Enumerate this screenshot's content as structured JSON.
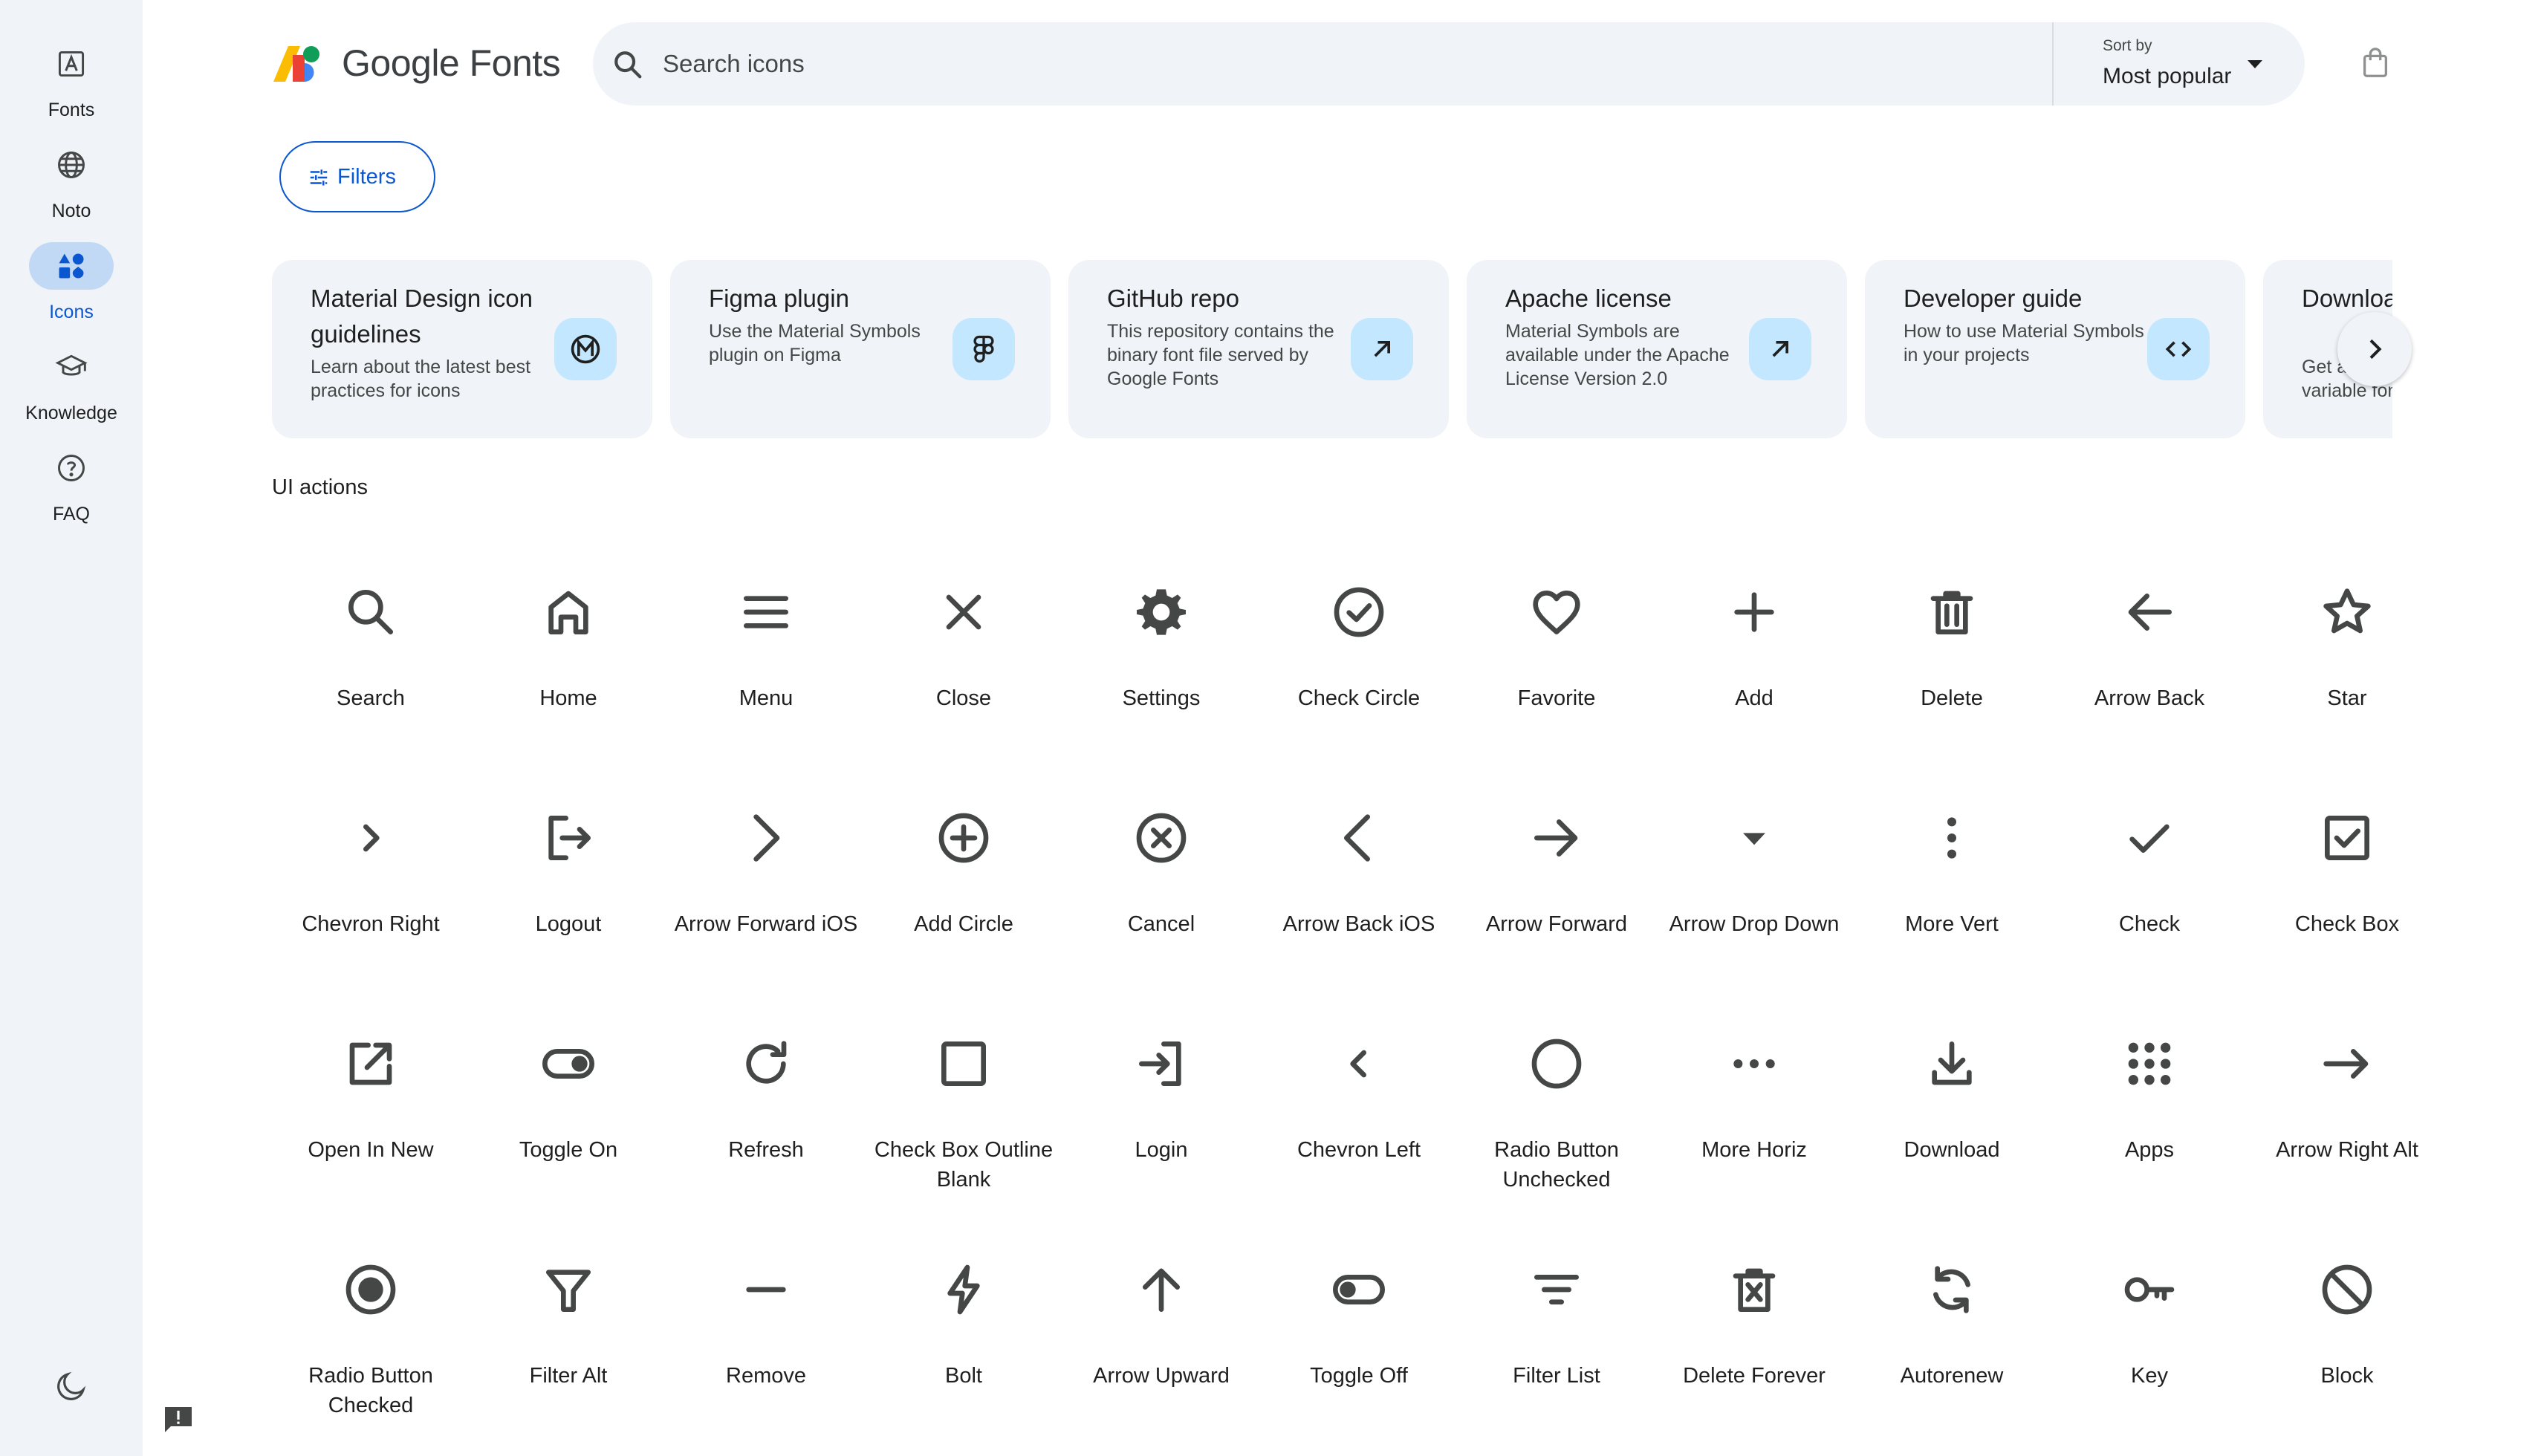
{
  "rail": {
    "items": [
      {
        "label": "Fonts",
        "icon": "font-icon"
      },
      {
        "label": "Noto",
        "icon": "globe-icon"
      },
      {
        "label": "Icons",
        "icon": "shapes-icon",
        "active": true
      },
      {
        "label": "Knowledge",
        "icon": "school-icon"
      },
      {
        "label": "FAQ",
        "icon": "help-icon"
      }
    ],
    "theme_icon": "dark-mode-icon",
    "feedback_icon": "feedback-icon"
  },
  "header": {
    "brand": "Google Fonts",
    "search_placeholder": "Search icons",
    "sort_caption": "Sort by",
    "sort_value": "Most popular"
  },
  "filters_label": "Filters",
  "cards": [
    {
      "title": "Material Design icon guidelines",
      "description": "Learn about the latest best practices for icons",
      "icon": "material-logo-icon"
    },
    {
      "title": "Figma plugin",
      "description": "Use the Material Symbols plugin on Figma",
      "icon": "figma-icon"
    },
    {
      "title": "GitHub repo",
      "description": "This repository contains the binary font file served by Google Fonts",
      "icon": "arrow-outward-icon"
    },
    {
      "title": "Apache license",
      "description": "Material Symbols are available under the Apache License Version 2.0",
      "icon": "arrow-outward-icon"
    },
    {
      "title": "Developer guide",
      "description": "How to use Material Symbols in your projects",
      "icon": "code-icon"
    },
    {
      "title": "Download all Symbols",
      "description": "Get all icons in a single variable font",
      "icon": "download-icon"
    }
  ],
  "section_title": "UI actions",
  "icons": [
    {
      "label": "Search",
      "icon": "search"
    },
    {
      "label": "Home",
      "icon": "home"
    },
    {
      "label": "Menu",
      "icon": "menu"
    },
    {
      "label": "Close",
      "icon": "close"
    },
    {
      "label": "Settings",
      "icon": "settings"
    },
    {
      "label": "Check Circle",
      "icon": "check_circle"
    },
    {
      "label": "Favorite",
      "icon": "favorite"
    },
    {
      "label": "Add",
      "icon": "add"
    },
    {
      "label": "Delete",
      "icon": "delete"
    },
    {
      "label": "Arrow Back",
      "icon": "arrow_back"
    },
    {
      "label": "Star",
      "icon": "star"
    },
    {
      "label": "Chevron Right",
      "icon": "chevron_right"
    },
    {
      "label": "Logout",
      "icon": "logout"
    },
    {
      "label": "Arrow Forward iOS",
      "icon": "arrow_forward_ios"
    },
    {
      "label": "Add Circle",
      "icon": "add_circle"
    },
    {
      "label": "Cancel",
      "icon": "cancel"
    },
    {
      "label": "Arrow Back iOS",
      "icon": "arrow_back_ios"
    },
    {
      "label": "Arrow Forward",
      "icon": "arrow_forward"
    },
    {
      "label": "Arrow Drop Down",
      "icon": "arrow_drop_down"
    },
    {
      "label": "More Vert",
      "icon": "more_vert"
    },
    {
      "label": "Check",
      "icon": "check"
    },
    {
      "label": "Check Box",
      "icon": "check_box"
    },
    {
      "label": "Open In New",
      "icon": "open_in_new"
    },
    {
      "label": "Toggle On",
      "icon": "toggle_on"
    },
    {
      "label": "Refresh",
      "icon": "refresh"
    },
    {
      "label": "Check Box Outline Blank",
      "icon": "check_box_outline_blank"
    },
    {
      "label": "Login",
      "icon": "login"
    },
    {
      "label": "Chevron Left",
      "icon": "chevron_left"
    },
    {
      "label": "Radio Button Unchecked",
      "icon": "radio_button_unchecked"
    },
    {
      "label": "More Horiz",
      "icon": "more_horiz"
    },
    {
      "label": "Download",
      "icon": "download"
    },
    {
      "label": "Apps",
      "icon": "apps"
    },
    {
      "label": "Arrow Right Alt",
      "icon": "arrow_right_alt"
    },
    {
      "label": "Radio Button Checked",
      "icon": "radio_button_checked"
    },
    {
      "label": "Filter Alt",
      "icon": "filter_alt"
    },
    {
      "label": "Remove",
      "icon": "remove"
    },
    {
      "label": "Bolt",
      "icon": "bolt"
    },
    {
      "label": "Arrow Upward",
      "icon": "arrow_upward"
    },
    {
      "label": "Toggle Off",
      "icon": "toggle_off"
    },
    {
      "label": "Filter List",
      "icon": "filter_list"
    },
    {
      "label": "Delete Forever",
      "icon": "delete_forever"
    },
    {
      "label": "Autorenew",
      "icon": "autorenew"
    },
    {
      "label": "Key",
      "icon": "key"
    },
    {
      "label": "Block",
      "icon": "block"
    }
  ],
  "colors": {
    "accent": "#0b57d0",
    "rail_bg": "#f0f4f9",
    "active_pill": "#c2d9f5",
    "badge_bg": "#c2e7ff",
    "icon_color": "#444746"
  }
}
